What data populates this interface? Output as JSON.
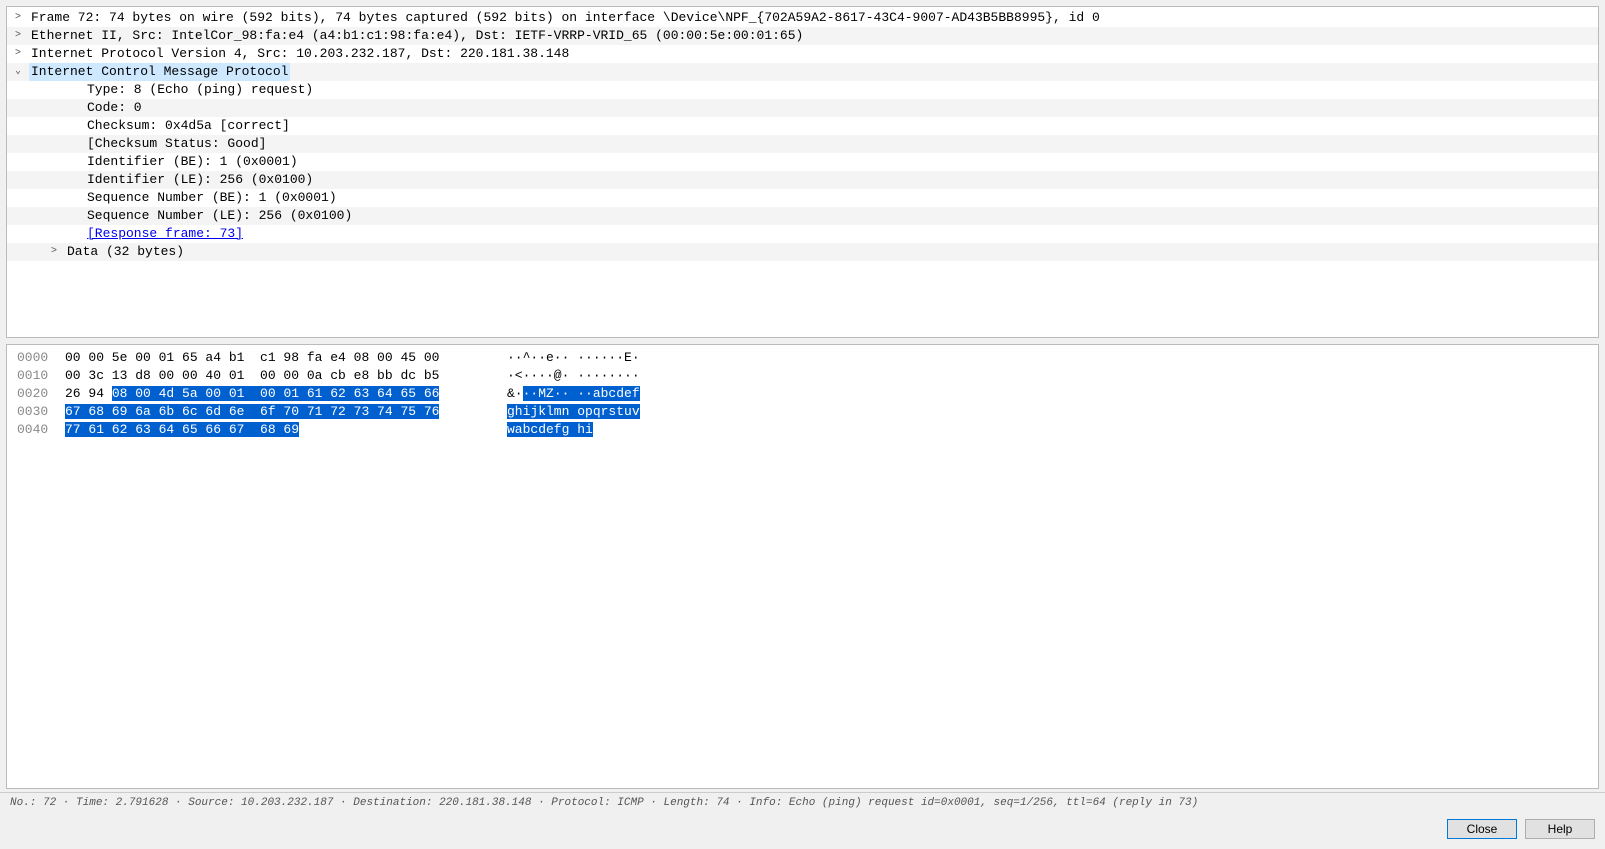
{
  "tree": [
    {
      "lvl": 0,
      "exp": ">",
      "alt": false,
      "text": "Frame 72: 74 bytes on wire (592 bits), 74 bytes captured (592 bits) on interface \\Device\\NPF_{702A59A2-8617-43C4-9007-AD43B5BB8995}, id 0"
    },
    {
      "lvl": 0,
      "exp": ">",
      "alt": true,
      "text": "Ethernet II, Src: IntelCor_98:fa:e4 (a4:b1:c1:98:fa:e4), Dst: IETF-VRRP-VRID_65 (00:00:5e:00:01:65)"
    },
    {
      "lvl": 0,
      "exp": ">",
      "alt": false,
      "text": "Internet Protocol Version 4, Src: 10.203.232.187, Dst: 220.181.38.148"
    },
    {
      "lvl": 0,
      "exp": "v",
      "alt": true,
      "sel": true,
      "text": "Internet Control Message Protocol"
    },
    {
      "lvl": 2,
      "exp": "",
      "alt": false,
      "text": "Type: 8 (Echo (ping) request)"
    },
    {
      "lvl": 2,
      "exp": "",
      "alt": true,
      "text": "Code: 0"
    },
    {
      "lvl": 2,
      "exp": "",
      "alt": false,
      "text": "Checksum: 0x4d5a [correct]"
    },
    {
      "lvl": 2,
      "exp": "",
      "alt": true,
      "text": "[Checksum Status: Good]"
    },
    {
      "lvl": 2,
      "exp": "",
      "alt": false,
      "text": "Identifier (BE): 1 (0x0001)"
    },
    {
      "lvl": 2,
      "exp": "",
      "alt": true,
      "text": "Identifier (LE): 256 (0x0100)"
    },
    {
      "lvl": 2,
      "exp": "",
      "alt": false,
      "text": "Sequence Number (BE): 1 (0x0001)"
    },
    {
      "lvl": 2,
      "exp": "",
      "alt": true,
      "text": "Sequence Number (LE): 256 (0x0100)"
    },
    {
      "lvl": 2,
      "exp": "",
      "alt": false,
      "link": true,
      "text": "[Response frame: 73]"
    },
    {
      "lvl": 1,
      "exp": ">",
      "alt": true,
      "text": "Data (32 bytes)"
    }
  ],
  "hex": [
    {
      "off": "0000",
      "pre": "00 00 5e 00 01 65 a4 b1  c1 98 fa e4 08 00 45 00",
      "sel": "",
      "ascpre": "··^··e·· ······E·",
      "ascsel": ""
    },
    {
      "off": "0010",
      "pre": "00 3c 13 d8 00 00 40 01  00 00 0a cb e8 bb dc b5",
      "sel": "",
      "ascpre": "·<····@· ········",
      "ascsel": ""
    },
    {
      "off": "0020",
      "pre": "26 94 ",
      "sel": "08 00 4d 5a 00 01  00 01 61 62 63 64 65 66",
      "ascpre": "&·",
      "ascsel": "··MZ·· ··abcdef"
    },
    {
      "off": "0030",
      "pre": "",
      "sel": "67 68 69 6a 6b 6c 6d 6e  6f 70 71 72 73 74 75 76",
      "ascpre": "",
      "ascsel": "ghijklmn opqrstuv"
    },
    {
      "off": "0040",
      "pre": "",
      "sel": "77 61 62 63 64 65 66 67  68 69",
      "ascpre": "",
      "ascsel": "wabcdefg hi"
    }
  ],
  "status": "No.: 72 · Time: 2.791628 · Source: 10.203.232.187 · Destination: 220.181.38.148 · Protocol: ICMP · Length: 74 · Info: Echo (ping) request id=0x0001, seq=1/256, ttl=64 (reply in 73)",
  "buttons": {
    "close": "Close",
    "help": "Help"
  }
}
